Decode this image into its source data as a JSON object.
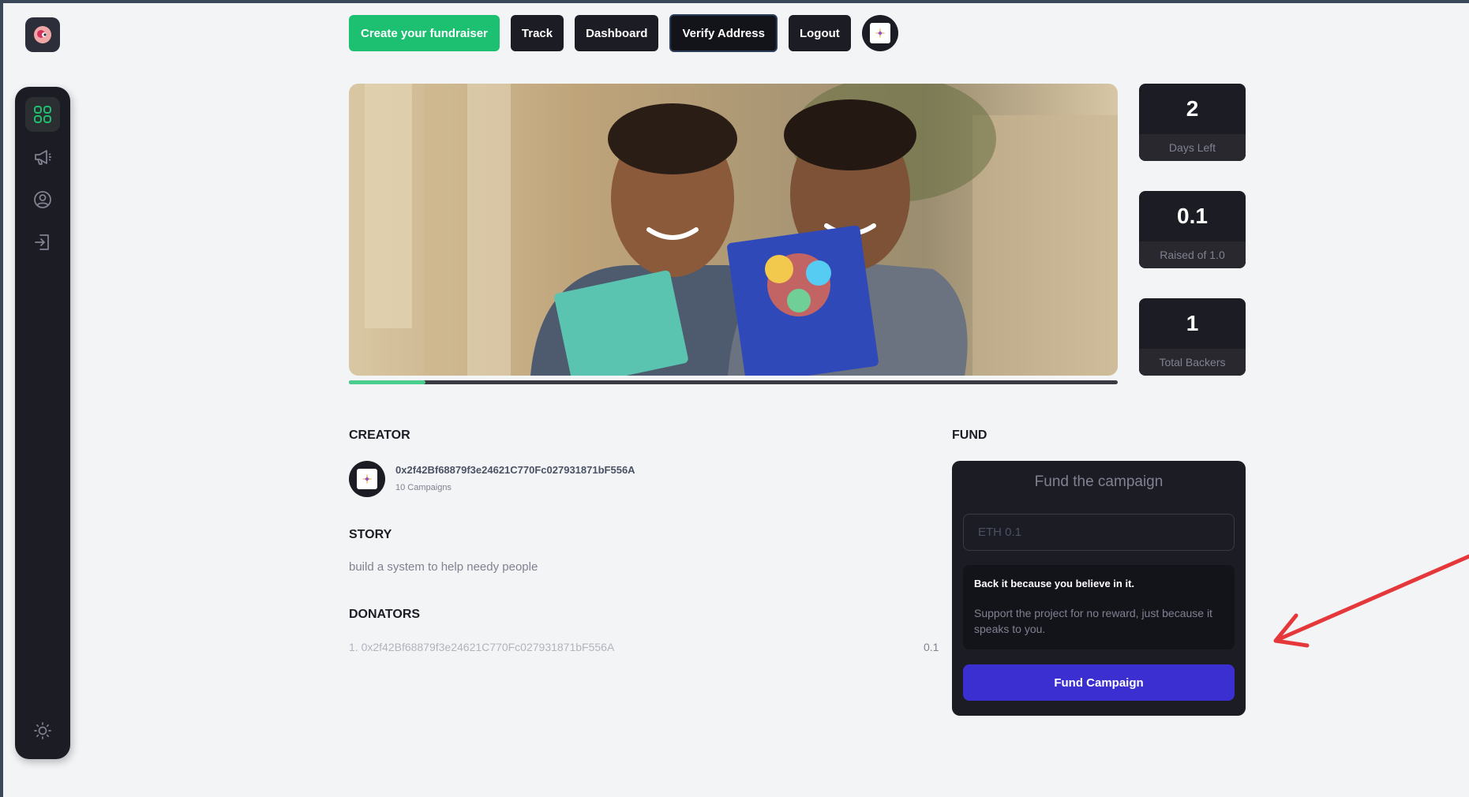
{
  "nav": {
    "create_label": "Create your fundraiser",
    "track_label": "Track",
    "dashboard_label": "Dashboard",
    "verify_label": "Verify Address",
    "logout_label": "Logout"
  },
  "campaign": {
    "progress_fraction": 0.1
  },
  "stats": [
    {
      "value": "2",
      "label": "Days Left"
    },
    {
      "value": "0.1",
      "label": "Raised of 1.0"
    },
    {
      "value": "1",
      "label": "Total Backers"
    }
  ],
  "creator": {
    "title": "CREATOR",
    "address": "0x2f42Bf68879f3e24621C770Fc027931871bF556A",
    "campaigns": "10 Campaigns"
  },
  "story": {
    "title": "STORY",
    "text": "build a system to help needy people"
  },
  "donators": {
    "title": "DONATORS",
    "items": [
      {
        "entry": "1. 0x2f42Bf68879f3e24621C770Fc027931871bF556A",
        "amount": "0.1"
      }
    ]
  },
  "fund": {
    "title": "FUND",
    "heading": "Fund the campaign",
    "placeholder": "ETH 0.1",
    "believe_title": "Back it because you believe in it.",
    "believe_text": "Support the project for no reward, just because it speaks to you.",
    "button_label": "Fund Campaign"
  },
  "colors": {
    "accent_green": "#1dc071",
    "fund_button": "#3b2fd1",
    "dark_card": "#1c1c24",
    "annotation_arrow": "#e5383b"
  },
  "icons": [
    "logo-icon",
    "dashboard-icon",
    "campaign-megaphone-icon",
    "profile-icon",
    "logout-icon",
    "theme-sun-icon",
    "wallet-avatar-icon"
  ]
}
